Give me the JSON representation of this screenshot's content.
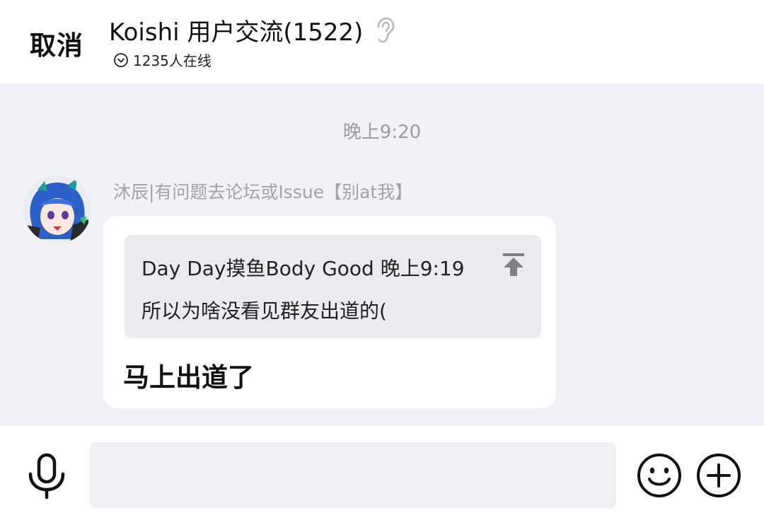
{
  "header": {
    "cancel_label": "取消",
    "title": "Koishi 用户交流(1522)",
    "online": "1235人在线",
    "icons": {
      "listen": "ear-icon",
      "expand": "chevron-circle-down-icon"
    }
  },
  "chat": {
    "timestamp": "晚上9:20",
    "messages": [
      {
        "sender": "沐辰|有问题去论坛或Issue【别at我】",
        "avatar": "anime-avatar-blue-hair",
        "reply": {
          "meta": "Day Day摸鱼Body Good 晚上9:19",
          "text": "所以为啥没看见群友出道的(",
          "icon": "jump-to-top-icon"
        },
        "text": "马上出道了"
      }
    ]
  },
  "input_bar": {
    "value": "",
    "placeholder": "",
    "icons": [
      "microphone-icon",
      "emoji-icon",
      "plus-icon"
    ]
  },
  "colors": {
    "background": "#f2f1f5",
    "bubble": "#ffffff",
    "quote_bg": "#ebeaee",
    "muted_text": "#a3a2a8"
  }
}
